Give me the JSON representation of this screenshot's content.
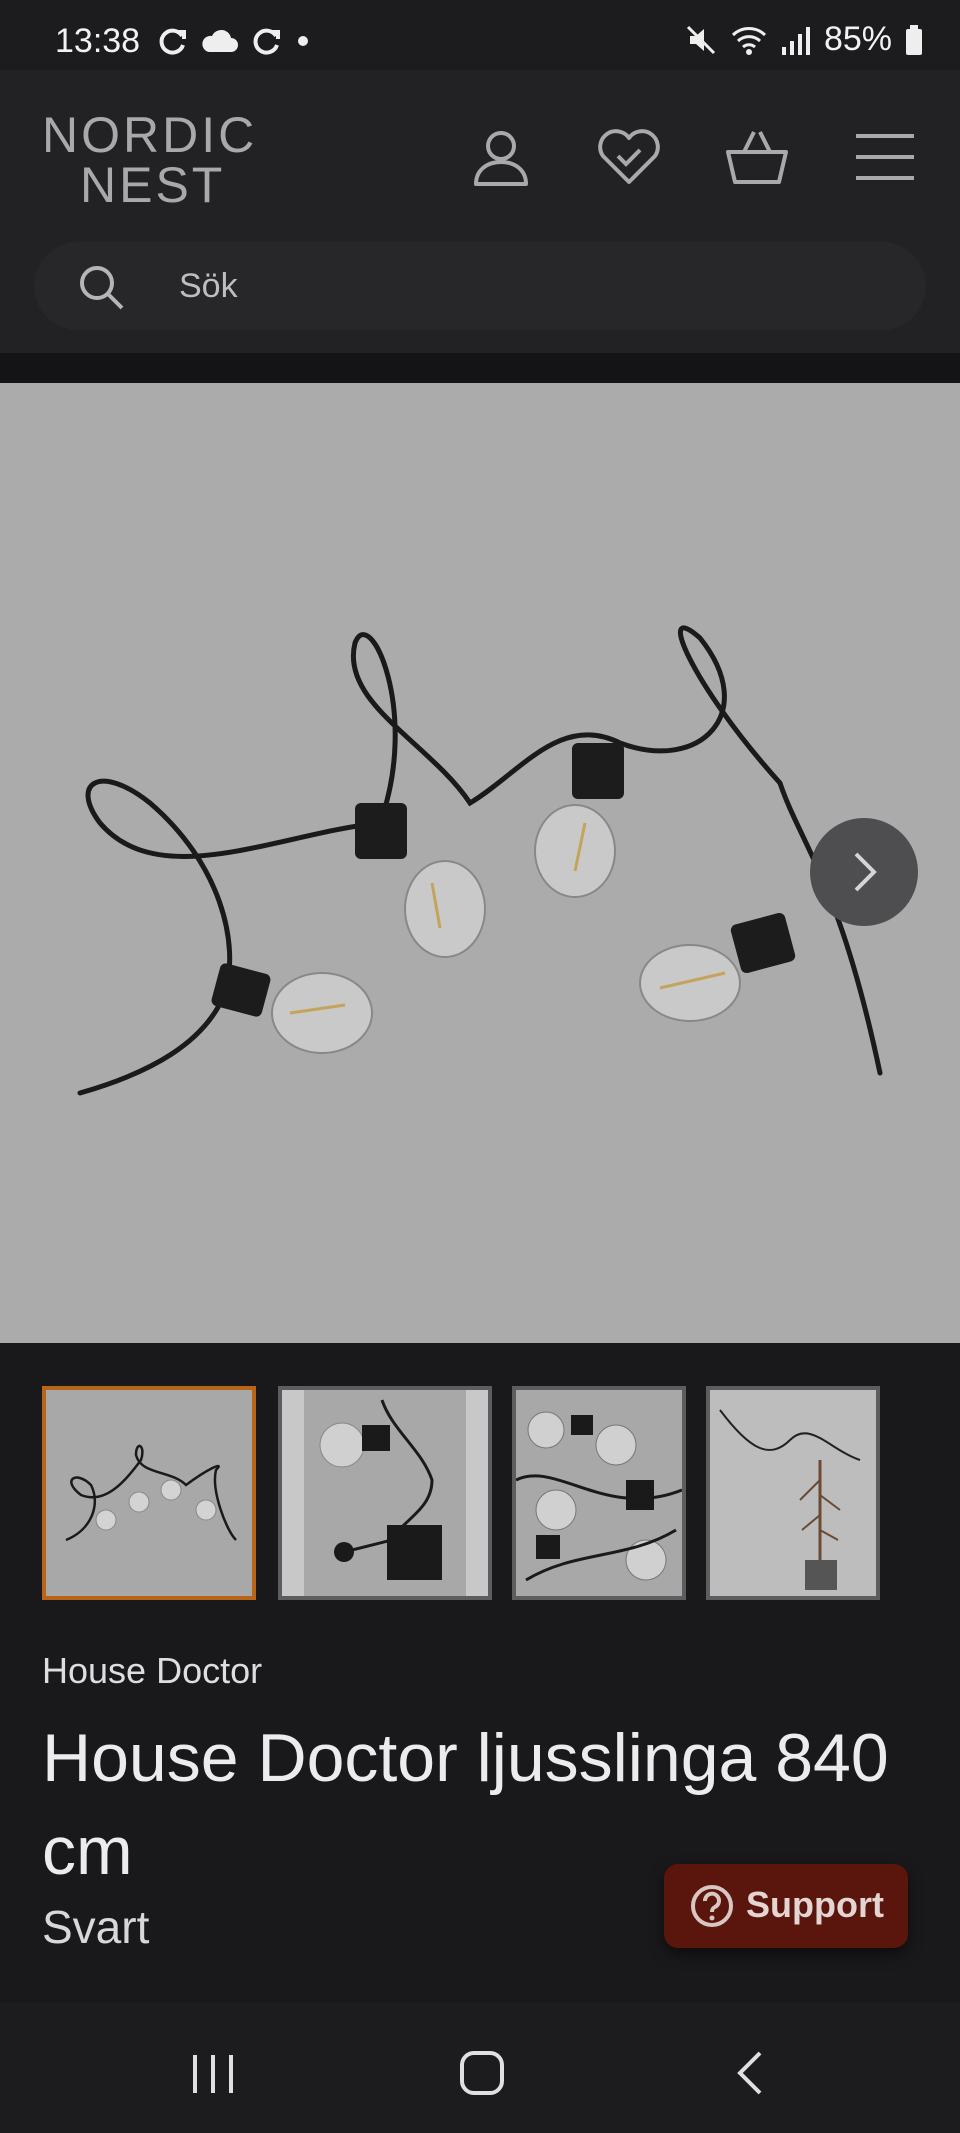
{
  "status_bar": {
    "time": "13:38",
    "battery": "85%",
    "left_icons": [
      "sync-icon",
      "cloud-icon",
      "sync-icon",
      "dot-icon"
    ],
    "right_icons": [
      "mute-icon",
      "wifi-icon",
      "signal-icon",
      "battery-icon"
    ]
  },
  "header": {
    "logo_line1": "NORDIC",
    "logo_line2": "NEST",
    "icons": [
      "account-icon",
      "wishlist-heart-icon",
      "basket-icon",
      "menu-icon"
    ],
    "search": {
      "placeholder": "Sök"
    }
  },
  "gallery": {
    "main_image": "string-lights-with-bulbs",
    "next_icon": "chevron-right-icon",
    "thumbnails": [
      {
        "name": "string-lights",
        "active": true
      },
      {
        "name": "plug-adapter",
        "active": false
      },
      {
        "name": "bulbs-closeup",
        "active": false
      },
      {
        "name": "lights-in-room",
        "active": false
      }
    ]
  },
  "product": {
    "brand": "House Doctor",
    "title": "House Doctor ljusslinga 840 cm",
    "variant": "Svart"
  },
  "support": {
    "label": "Support"
  },
  "nav_bar": {
    "icons": [
      "recent-apps-icon",
      "home-icon",
      "back-icon"
    ]
  },
  "colors": {
    "background": "#19191b",
    "header": "#222224",
    "hero_bg": "#ababab",
    "active_thumb_border": "#b8651a",
    "support_button": "#5a150d"
  }
}
